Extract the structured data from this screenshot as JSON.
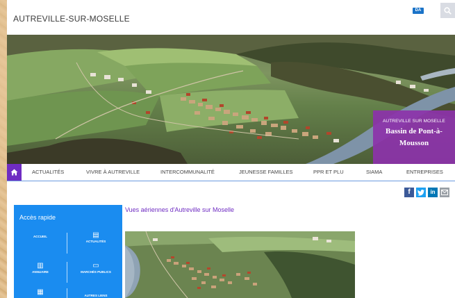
{
  "header": {
    "site_title": "AUTREVILLE-SUR-MOSELLE",
    "accessibility_badge": "DA",
    "search_icon": "search-icon"
  },
  "hero": {
    "badge_small": "AUTREVILLE SUR MOSELLE",
    "badge_big_line1": "Bassin de Pont-à-",
    "badge_big_line2": "Mousson"
  },
  "nav": {
    "home_icon": "home-icon",
    "items": [
      "ACTUALITÉS",
      "VIVRE À AUTREVILLE",
      "INTERCOMMUNALITÉ",
      "JEUNESSE FAMILLES",
      "PPR ET PLU",
      "SIAMA",
      "ENTREPRISES"
    ]
  },
  "social": {
    "facebook": "f",
    "twitter": "t",
    "linkedin": "in",
    "email_icon": "mail-icon",
    "colors": {
      "facebook": "#3b5998",
      "twitter": "#1da1f2",
      "linkedin": "#0077b5",
      "email": "#9aa0a6"
    }
  },
  "quick_access": {
    "title": "Accès rapide",
    "items": [
      {
        "label": "ACCUEIL",
        "icon": ""
      },
      {
        "label": "ACTUALITÉS",
        "icon": "▤"
      },
      {
        "label": "ANNUAIRE",
        "icon": "▥"
      },
      {
        "label": "MARCHÉS PUBLICS",
        "icon": "▭"
      },
      {
        "label": "",
        "icon": "▦"
      },
      {
        "label": "AUTRES LIENS",
        "icon": ""
      }
    ]
  },
  "article": {
    "title": "Vues aériennes d'Autreville sur Moselle"
  },
  "colors": {
    "accent_purple": "#6f2cc2",
    "quick_blue": "#1a8cf0"
  }
}
